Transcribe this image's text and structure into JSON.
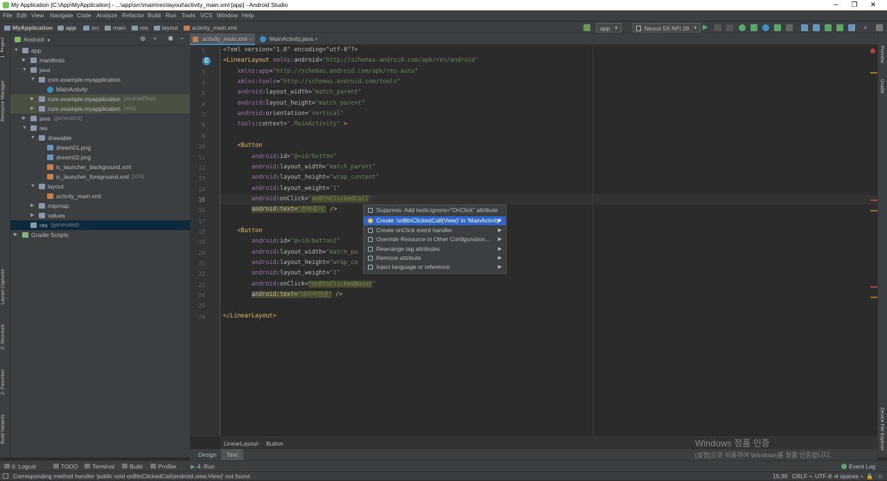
{
  "window": {
    "title": "My Application [C:\\App\\MyApplication] - ...\\app\\src\\main\\res\\layout\\activity_main.xml [app] - Android Studio",
    "minimize": "─",
    "maximize": "❐",
    "close": "✕"
  },
  "menu": [
    "File",
    "Edit",
    "View",
    "Navigate",
    "Code",
    "Analyze",
    "Refactor",
    "Build",
    "Run",
    "Tools",
    "VCS",
    "Window",
    "Help"
  ],
  "breadcrumbs": [
    "MyApplication",
    "app",
    "src",
    "main",
    "res",
    "layout",
    "activity_main.xml"
  ],
  "toolbar": {
    "run_config": "app",
    "device": "Nexus 5X API 28"
  },
  "left_tools": [
    "1: Project",
    "Resource Manager",
    "Layout Captures",
    "Z: Structure",
    "2: Favorites",
    "Build Variants"
  ],
  "right_tools": [
    "Preview",
    "Gradle",
    "Device File Explorer"
  ],
  "project": {
    "view_mode": "Android",
    "tree": [
      {
        "label": "app",
        "suffix": "",
        "indent": 0,
        "arrow": "▼",
        "icon": "folder"
      },
      {
        "label": "manifests",
        "suffix": "",
        "indent": 1,
        "arrow": "▶",
        "icon": "folder"
      },
      {
        "label": "java",
        "suffix": "",
        "indent": 1,
        "arrow": "▼",
        "icon": "folder"
      },
      {
        "label": "com.example.myapplication",
        "suffix": "",
        "indent": 2,
        "arrow": "▼",
        "icon": "folder"
      },
      {
        "label": "MainActivity",
        "suffix": "",
        "indent": 3,
        "arrow": "",
        "icon": "class"
      },
      {
        "label": "com.example.myapplication",
        "suffix": "(androidTest)",
        "indent": 2,
        "arrow": "▶",
        "icon": "folder",
        "hl": true
      },
      {
        "label": "com.example.myapplication",
        "suffix": "(test)",
        "indent": 2,
        "arrow": "▶",
        "icon": "folder",
        "hl": true
      },
      {
        "label": "java",
        "suffix": "(generated)",
        "indent": 1,
        "arrow": "▶",
        "icon": "folder"
      },
      {
        "label": "res",
        "suffix": "",
        "indent": 1,
        "arrow": "▼",
        "icon": "folder"
      },
      {
        "label": "drawable",
        "suffix": "",
        "indent": 2,
        "arrow": "▼",
        "icon": "folder"
      },
      {
        "label": "dream01.png",
        "suffix": "",
        "indent": 3,
        "arrow": "",
        "icon": "file"
      },
      {
        "label": "dream02.png",
        "suffix": "",
        "indent": 3,
        "arrow": "",
        "icon": "file"
      },
      {
        "label": "ic_launcher_background.xml",
        "suffix": "",
        "indent": 3,
        "arrow": "",
        "icon": "xml"
      },
      {
        "label": "ic_launcher_foreground.xml",
        "suffix": "(v24)",
        "indent": 3,
        "arrow": "",
        "icon": "xml"
      },
      {
        "label": "layout",
        "suffix": "",
        "indent": 2,
        "arrow": "▼",
        "icon": "folder"
      },
      {
        "label": "activity_main.xml",
        "suffix": "",
        "indent": 3,
        "arrow": "",
        "icon": "xml"
      },
      {
        "label": "mipmap",
        "suffix": "",
        "indent": 2,
        "arrow": "▶",
        "icon": "folder"
      },
      {
        "label": "values",
        "suffix": "",
        "indent": 2,
        "arrow": "▶",
        "icon": "folder"
      },
      {
        "label": "res",
        "suffix": "(generated)",
        "indent": 1,
        "arrow": "",
        "icon": "folder",
        "sel": true
      },
      {
        "label": "Gradle Scripts",
        "suffix": "",
        "indent": 0,
        "arrow": "▶",
        "icon": "gradle"
      }
    ]
  },
  "tabs": [
    {
      "label": "activity_main.xml",
      "active": true
    },
    {
      "label": "MainActivity.java",
      "active": false
    }
  ],
  "code_lines": [
    [
      [
        "<?xml version=\"1.0\" encoding=\"utf-8\"?>",
        "an"
      ]
    ],
    [
      [
        "<LinearLayout ",
        "tag"
      ],
      [
        "xmlns:",
        "ns"
      ],
      [
        "android",
        "an"
      ],
      [
        "=",
        "an"
      ],
      [
        "\"http://schemas.android.com/apk/res/android\"",
        "av"
      ]
    ],
    [
      [
        "    ",
        ""
      ],
      [
        "xmlns:app",
        "ns"
      ],
      [
        "=",
        "an"
      ],
      [
        "\"http://schemas.android.com/apk/res-auto\"",
        "av"
      ]
    ],
    [
      [
        "    ",
        ""
      ],
      [
        "xmlns:tools",
        "ns"
      ],
      [
        "=",
        "an"
      ],
      [
        "\"http://schemas.android.com/tools\"",
        "av"
      ]
    ],
    [
      [
        "    ",
        ""
      ],
      [
        "android",
        "ns"
      ],
      [
        ":layout_width=",
        "an"
      ],
      [
        "\"match_parent\"",
        "av"
      ]
    ],
    [
      [
        "    ",
        ""
      ],
      [
        "android",
        "ns"
      ],
      [
        ":layout_height=",
        "an"
      ],
      [
        "\"match_parent\"",
        "av"
      ]
    ],
    [
      [
        "    ",
        ""
      ],
      [
        "android",
        "ns"
      ],
      [
        ":orientation=",
        "an"
      ],
      [
        "\"vertical\"",
        "av"
      ]
    ],
    [
      [
        "    ",
        ""
      ],
      [
        "tools",
        "ns"
      ],
      [
        ":context=",
        "an"
      ],
      [
        "\".MainActivity\"",
        "av"
      ],
      [
        " >",
        "tag"
      ]
    ],
    [
      [
        "",
        ""
      ]
    ],
    [
      [
        "    ",
        ""
      ],
      [
        "<Button",
        "tag"
      ]
    ],
    [
      [
        "        ",
        ""
      ],
      [
        "android",
        "ns"
      ],
      [
        ":id=",
        "an"
      ],
      [
        "\"@+id/button\"",
        "av"
      ]
    ],
    [
      [
        "        ",
        ""
      ],
      [
        "android",
        "ns"
      ],
      [
        ":layout_width=",
        "an"
      ],
      [
        "\"match_parent\"",
        "av"
      ]
    ],
    [
      [
        "        ",
        ""
      ],
      [
        "android",
        "ns"
      ],
      [
        ":layout_height=",
        "an"
      ],
      [
        "\"wrap_content\"",
        "av"
      ]
    ],
    [
      [
        "        ",
        ""
      ],
      [
        "android",
        "ns"
      ],
      [
        ":layout_weight=",
        "an"
      ],
      [
        "\"1\"",
        "av"
      ]
    ],
    [
      [
        "        ",
        ""
      ],
      [
        "android",
        "ns"
      ],
      [
        ":onClick=",
        "an"
      ],
      [
        "\"",
        "av"
      ],
      [
        "onBtnClickedCall",
        "avh"
      ],
      [
        "\"",
        "av"
      ]
    ],
    [
      [
        "        ",
        ""
      ],
      [
        "android:text=",
        "hl"
      ],
      [
        "\"전화걸기\"",
        "avh"
      ],
      [
        " />",
        "tag"
      ]
    ],
    [
      [
        "",
        ""
      ]
    ],
    [
      [
        "    ",
        ""
      ],
      [
        "<Button",
        "tag"
      ]
    ],
    [
      [
        "        ",
        ""
      ],
      [
        "android",
        "ns"
      ],
      [
        ":id=",
        "an"
      ],
      [
        "\"@+id/button2\"",
        "av"
      ]
    ],
    [
      [
        "        ",
        ""
      ],
      [
        "android",
        "ns"
      ],
      [
        ":layout_width=",
        "an"
      ],
      [
        "\"match_pa",
        "av"
      ]
    ],
    [
      [
        "        ",
        ""
      ],
      [
        "android",
        "ns"
      ],
      [
        ":layout_height=",
        "an"
      ],
      [
        "\"wrap_co",
        "av"
      ]
    ],
    [
      [
        "        ",
        ""
      ],
      [
        "android",
        "ns"
      ],
      [
        ":layout_weight=",
        "an"
      ],
      [
        "\"1\"",
        "av"
      ]
    ],
    [
      [
        "        ",
        ""
      ],
      [
        "android",
        "ns"
      ],
      [
        ":onClick=",
        "an"
      ],
      [
        "\"onBtnClickedNaver",
        "avh"
      ],
      [
        "\"",
        "av"
      ]
    ],
    [
      [
        "        ",
        ""
      ],
      [
        "android:text=",
        "hl"
      ],
      [
        "\"네이버연결\"",
        "avh"
      ],
      [
        " />",
        "tag"
      ]
    ],
    [
      [
        "",
        ""
      ]
    ],
    [
      [
        "</LinearLayout>",
        "tag"
      ]
    ]
  ],
  "popup": [
    {
      "label": "Suppress: Add tools:ignore=\"OnClick\" attribute",
      "arrow": false,
      "sel": false
    },
    {
      "label": "Create 'onBtnClickedCall(View)' in 'MainActivity'",
      "arrow": true,
      "sel": true
    },
    {
      "label": "Create onClick event handler",
      "arrow": true,
      "sel": false
    },
    {
      "label": "Override Resource in Other Configuration...",
      "arrow": true,
      "sel": false
    },
    {
      "label": "Rearrange tag attributes",
      "arrow": true,
      "sel": false
    },
    {
      "label": "Remove attribute",
      "arrow": true,
      "sel": false
    },
    {
      "label": "Inject language or reference",
      "arrow": true,
      "sel": false
    }
  ],
  "editor_crumbs": [
    "LinearLayout",
    "Button"
  ],
  "design_tabs": [
    "Design",
    "Text"
  ],
  "bottom_tools": [
    "6: Logcat",
    "TODO",
    "Terminal",
    "Build",
    "Profiler",
    "4: Run"
  ],
  "event_log": "Event Log",
  "status": {
    "message": "Corresponding method handler 'public void onBtnClickedCall(android.view.View)' not found",
    "position": "15:39",
    "line_sep": "CRLF ÷",
    "encoding": "UTF-8 ÷",
    "indent": "4 spaces ÷"
  },
  "activation": {
    "line1": "Windows 정품 인증",
    "line2": "[설정]으로 이동하여 Windows를 정품 인증합니다."
  },
  "colors": {
    "accent": "#2f65ca",
    "background": "#2b2b2b",
    "panel": "#3c3f41"
  }
}
